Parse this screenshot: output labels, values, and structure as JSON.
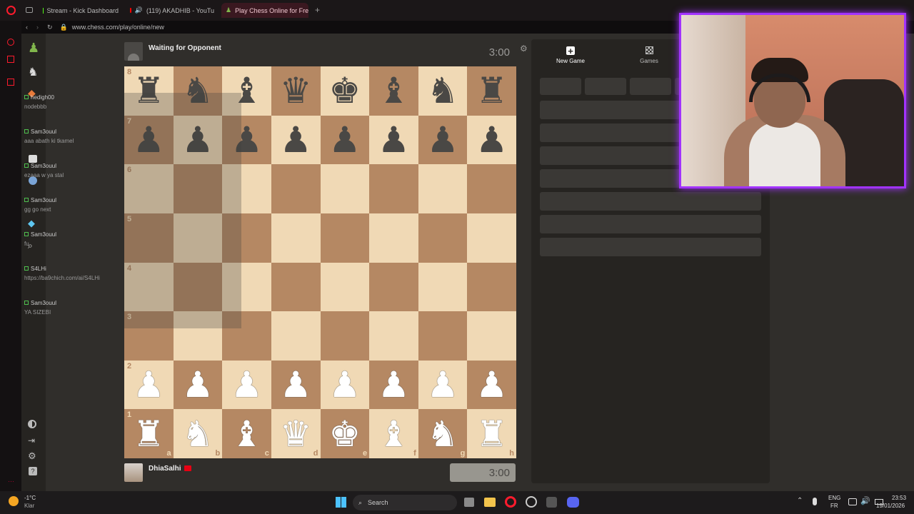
{
  "browser": {
    "tabs": [
      {
        "label": "Stream - Kick Dashboard",
        "active": false
      },
      {
        "label": "(119) AKADHIB - YouTu",
        "active": false
      },
      {
        "label": "Play Chess Online for Free",
        "active": true
      }
    ],
    "url": "www.chess.com/play/online/new"
  },
  "chat": [
    {
      "name": "hedigh00",
      "text": "nodebbb"
    },
    {
      "name": "Sam3ouul",
      "text": "aaa abath ki tkamel"
    },
    {
      "name": "Sam3ouul",
      "text": "ezaaa w ya stal"
    },
    {
      "name": "Sam3ouul",
      "text": "gg go next"
    },
    {
      "name": "Sam3ouul",
      "text": "fu"
    },
    {
      "name": "S4LHi",
      "text": "https://ba9chich.com/ai/S4LHi"
    },
    {
      "name": "Sam3ouul",
      "text": "YA SIZEBI"
    }
  ],
  "game": {
    "opponent_label": "Waiting for Opponent",
    "opponent_clock": "3:00",
    "player_name": "DhiaSalhi",
    "player_clock": "3:00",
    "ranks": [
      "8",
      "7",
      "6",
      "5",
      "4",
      "3",
      "2",
      "1"
    ],
    "files": [
      "a",
      "b",
      "c",
      "d",
      "e",
      "f",
      "g",
      "h"
    ],
    "position": [
      [
        "♜",
        "♞",
        "♝",
        "♛",
        "♚",
        "♝",
        "♞",
        "♜"
      ],
      [
        "♟",
        "♟",
        "♟",
        "♟",
        "♟",
        "♟",
        "♟",
        "♟"
      ],
      [
        "",
        "",
        "",
        "",
        "",
        "",
        "",
        ""
      ],
      [
        "",
        "",
        "",
        "",
        "",
        "",
        "",
        ""
      ],
      [
        "",
        "",
        "",
        "",
        "",
        "",
        "",
        ""
      ],
      [
        "",
        "",
        "",
        "",
        "",
        "",
        "",
        ""
      ],
      [
        "♟",
        "♟",
        "♟",
        "♟",
        "♟",
        "♟",
        "♟",
        "♟"
      ],
      [
        "♜",
        "♞",
        "♝",
        "♛",
        "♚",
        "♝",
        "♞",
        "♜"
      ]
    ]
  },
  "panel": {
    "tabs": [
      {
        "label": "New Game",
        "icon": "plus-icon"
      },
      {
        "label": "Games",
        "icon": "board-icon"
      }
    ]
  },
  "taskbar": {
    "weather_temp": "-1°C",
    "weather_desc": "Klar",
    "search_placeholder": "Search",
    "lang_top": "ENG",
    "lang_bottom": "FR",
    "time": "23:53",
    "date": "19/01/2026"
  },
  "colors": {
    "accent": "#a233ff",
    "light_square": "#f0d9b5",
    "dark_square": "#b58863",
    "opera_red": "#ff1b2d"
  }
}
